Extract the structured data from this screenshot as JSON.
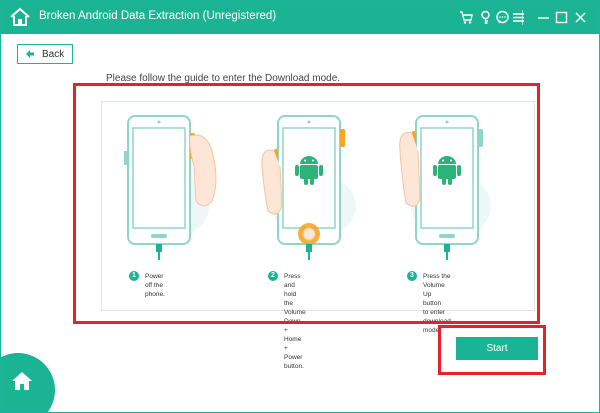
{
  "window": {
    "title": "Broken Android Data Extraction (Unregistered)"
  },
  "titlebar_icons": [
    "home-icon",
    "cart-icon",
    "key-icon",
    "chat-icon",
    "menu-icon",
    "minimize-icon",
    "maximize-icon",
    "close-icon"
  ],
  "toolbar": {
    "back_label": "Back"
  },
  "guide": {
    "instruction": "Please follow the guide to enter the Download mode.",
    "steps": [
      {
        "num": "1",
        "text": "Power off the phone."
      },
      {
        "num": "2",
        "text": "Press and hold the Volume\nDown + Home + Power\nbutton."
      },
      {
        "num": "3",
        "text": "Press the Volume Up button\nto enter download mode."
      }
    ]
  },
  "actions": {
    "start_label": "Start"
  },
  "colors": {
    "accent": "#1ab394",
    "highlight": "#e2232a",
    "phone_outline": "#8fd6c8",
    "finger": "#f5a623"
  }
}
